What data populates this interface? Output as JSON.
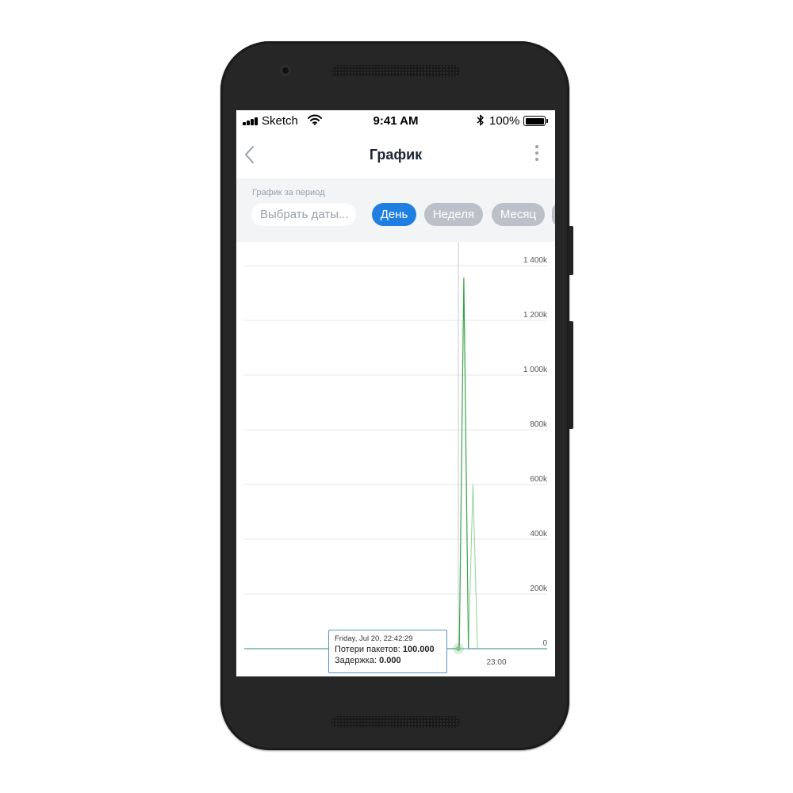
{
  "status_bar": {
    "carrier": "Sketch",
    "time": "9:41 AM",
    "battery": "100%"
  },
  "nav": {
    "title": "График",
    "back_icon": "chevron-left-icon",
    "more_icon": "more-vertical-icon"
  },
  "filter": {
    "label": "График за период",
    "date_placeholder": "Выбрать даты...",
    "periods": [
      {
        "label": "День",
        "active": true
      },
      {
        "label": "Неделя",
        "active": false
      },
      {
        "label": "Месяц",
        "active": false
      }
    ]
  },
  "colors": {
    "accent": "#1f7fe0",
    "inactive_pill": "#bcc1c9",
    "series_loss": "#3aa24a",
    "series_delay": "#8fd19a"
  },
  "chart_data": {
    "type": "line",
    "y_ticks": [
      "1 400k",
      "1 200k",
      "1 000k",
      "800k",
      "600k",
      "400k",
      "200k",
      "0"
    ],
    "y_tick_values": [
      1400000,
      1200000,
      1000000,
      800000,
      600000,
      400000,
      200000,
      0
    ],
    "x_ticks": [
      "23:00"
    ],
    "ylim": [
      0,
      1400000
    ],
    "grid": true,
    "series": [
      {
        "name": "Потери пакетов",
        "color": "#3aa24a",
        "points": [
          [
            0.0,
            0
          ],
          [
            0.71,
            0
          ],
          [
            0.725,
            1355000
          ],
          [
            0.74,
            0
          ],
          [
            1.0,
            0
          ]
        ]
      },
      {
        "name": "Задержка",
        "color": "#8fd19a",
        "points": [
          [
            0.0,
            0
          ],
          [
            0.74,
            0
          ],
          [
            0.755,
            600000
          ],
          [
            0.77,
            0
          ],
          [
            1.0,
            0
          ]
        ]
      }
    ],
    "tooltip": {
      "date": "Friday, Jul 20, 22:42:29",
      "rows": [
        {
          "label": "Потери пакетов:",
          "value": "100.000"
        },
        {
          "label": "Задержка:",
          "value": "0.000"
        }
      ]
    }
  }
}
